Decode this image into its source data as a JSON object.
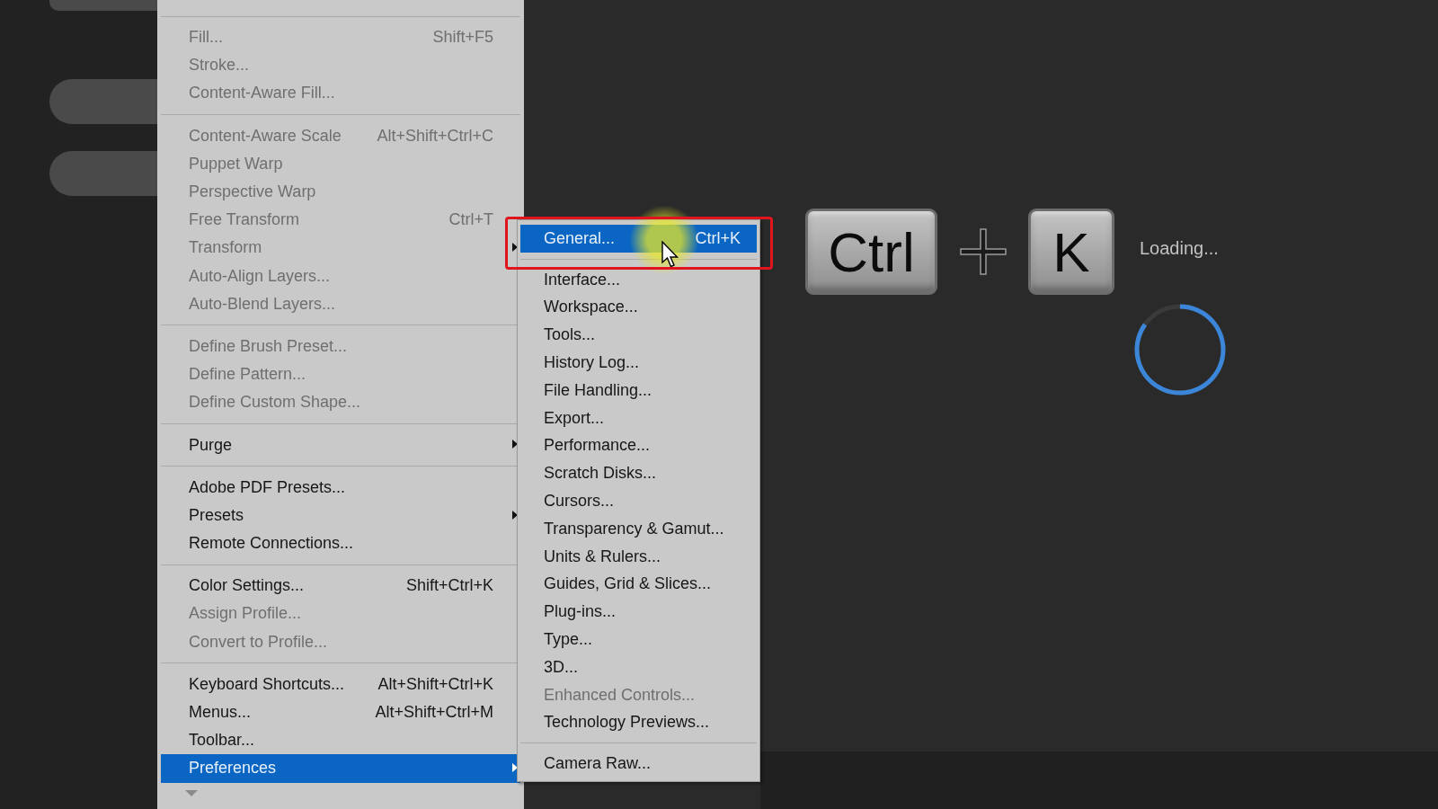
{
  "menu": {
    "groups": [
      {
        "items": [
          {
            "label": "Fill...",
            "shortcut": "Shift+F5",
            "disabled": true,
            "selected": false,
            "submenu": false
          },
          {
            "label": "Stroke...",
            "disabled": true,
            "selected": false,
            "submenu": false
          },
          {
            "label": "Content-Aware Fill...",
            "disabled": true,
            "selected": false,
            "submenu": false
          }
        ]
      },
      {
        "items": [
          {
            "label": "Content-Aware Scale",
            "shortcut": "Alt+Shift+Ctrl+C",
            "disabled": true,
            "selected": false,
            "submenu": false
          },
          {
            "label": "Puppet Warp",
            "disabled": true,
            "selected": false,
            "submenu": false
          },
          {
            "label": "Perspective Warp",
            "disabled": true,
            "selected": false,
            "submenu": false
          },
          {
            "label": "Free Transform",
            "shortcut": "Ctrl+T",
            "disabled": true,
            "selected": false,
            "submenu": false
          },
          {
            "label": "Transform",
            "disabled": true,
            "selected": false,
            "submenu": true
          },
          {
            "label": "Auto-Align Layers...",
            "disabled": true,
            "selected": false,
            "submenu": false
          },
          {
            "label": "Auto-Blend Layers...",
            "disabled": true,
            "selected": false,
            "submenu": false
          }
        ]
      },
      {
        "items": [
          {
            "label": "Define Brush Preset...",
            "disabled": true,
            "selected": false,
            "submenu": false
          },
          {
            "label": "Define Pattern...",
            "disabled": true,
            "selected": false,
            "submenu": false
          },
          {
            "label": "Define Custom Shape...",
            "disabled": true,
            "selected": false,
            "submenu": false
          }
        ]
      },
      {
        "items": [
          {
            "label": "Purge",
            "disabled": false,
            "selected": false,
            "submenu": true
          }
        ]
      },
      {
        "items": [
          {
            "label": "Adobe PDF Presets...",
            "disabled": false,
            "selected": false,
            "submenu": false
          },
          {
            "label": "Presets",
            "disabled": false,
            "selected": false,
            "submenu": true
          },
          {
            "label": "Remote Connections...",
            "disabled": false,
            "selected": false,
            "submenu": false
          }
        ]
      },
      {
        "items": [
          {
            "label": "Color Settings...",
            "shortcut": "Shift+Ctrl+K",
            "disabled": false,
            "selected": false,
            "submenu": false
          },
          {
            "label": "Assign Profile...",
            "disabled": true,
            "selected": false,
            "submenu": false
          },
          {
            "label": "Convert to Profile...",
            "disabled": true,
            "selected": false,
            "submenu": false
          }
        ]
      },
      {
        "items": [
          {
            "label": "Keyboard Shortcuts...",
            "shortcut": "Alt+Shift+Ctrl+K",
            "disabled": false,
            "selected": false,
            "submenu": false
          },
          {
            "label": "Menus...",
            "shortcut": "Alt+Shift+Ctrl+M",
            "disabled": false,
            "selected": false,
            "submenu": false
          },
          {
            "label": "Toolbar...",
            "disabled": false,
            "selected": false,
            "submenu": false
          },
          {
            "label": "Preferences",
            "disabled": false,
            "selected": true,
            "submenu": true
          }
        ]
      }
    ]
  },
  "submenu": {
    "groups": [
      {
        "items": [
          {
            "label": "General...",
            "shortcut": "Ctrl+K",
            "disabled": false,
            "selected": true
          }
        ]
      },
      {
        "items": [
          {
            "label": "Interface...",
            "disabled": false,
            "selected": false
          },
          {
            "label": "Workspace...",
            "disabled": false,
            "selected": false
          },
          {
            "label": "Tools...",
            "disabled": false,
            "selected": false
          },
          {
            "label": "History Log...",
            "disabled": false,
            "selected": false
          },
          {
            "label": "File Handling...",
            "disabled": false,
            "selected": false
          },
          {
            "label": "Export...",
            "disabled": false,
            "selected": false
          },
          {
            "label": "Performance...",
            "disabled": false,
            "selected": false
          },
          {
            "label": "Scratch Disks...",
            "disabled": false,
            "selected": false
          },
          {
            "label": "Cursors...",
            "disabled": false,
            "selected": false
          },
          {
            "label": "Transparency & Gamut...",
            "disabled": false,
            "selected": false
          },
          {
            "label": "Units & Rulers...",
            "disabled": false,
            "selected": false
          },
          {
            "label": "Guides, Grid & Slices...",
            "disabled": false,
            "selected": false
          },
          {
            "label": "Plug-ins...",
            "disabled": false,
            "selected": false
          },
          {
            "label": "Type...",
            "disabled": false,
            "selected": false
          },
          {
            "label": "3D...",
            "disabled": false,
            "selected": false
          },
          {
            "label": "Enhanced Controls...",
            "disabled": true,
            "selected": false
          },
          {
            "label": "Technology Previews...",
            "disabled": false,
            "selected": false
          }
        ]
      },
      {
        "items": [
          {
            "label": "Camera Raw...",
            "disabled": false,
            "selected": false
          }
        ]
      }
    ]
  },
  "shortcut_overlay": {
    "keys": [
      "Ctrl",
      "K"
    ],
    "status": "Loading..."
  }
}
